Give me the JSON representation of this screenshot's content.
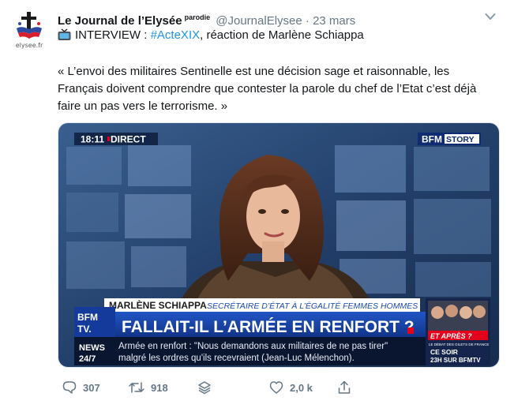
{
  "account": {
    "avatar_caption": "elysee.fr",
    "name": "Le Journal de l’Elysée",
    "parody_badge": "parodie",
    "handle": "@JournalElysee",
    "separator": "·",
    "date": "23 mars"
  },
  "tweet": {
    "prefix": "INTERVIEW : ",
    "hashtag": "#ActeXIX",
    "suffix": ", réaction de Marlène Schiappa",
    "quote": "« L’envoi des militaires Sentinelle est une décision sage et raisonnable, les Français doivent comprendre que contester la parole du chef de l’Etat c’est déjà faire un pas vers le terrorisme. »"
  },
  "media": {
    "time": "18:11",
    "live": "DIRECT",
    "channel_logo_a": "BFM",
    "channel_logo_b": "STORY",
    "guest_name": "MARLÈNE SCHIAPPA",
    "guest_title": "SECRÉTAIRE D’ÉTAT À L’ÉGALITÉ FEMMES HOMMES",
    "bfm_line1": "BFM",
    "bfm_line2": "TV.",
    "headline": "FALLAIT-IL L’ARMÉE EN RENFORT ?",
    "news_line1": "NEWS",
    "news_line2": "24/7",
    "ticker_line1": "Armée en renfort : \"Nous demandons aux militaires de ne pas tirer\"",
    "ticker_line2": "malgré les ordres qu'ils recevraient (Jean-Luc Mélenchon).",
    "promo_title": "ET APRÈS ?",
    "promo_sub": "LE DÉBAT DES GILETS DE FRANCE",
    "promo_line1": "CE SOIR",
    "promo_line2": "23H SUR BFMTV"
  },
  "actions": {
    "replies": "307",
    "retweets": "918",
    "likes": "2,0 k"
  },
  "icons": {
    "avatar": "elysee-cross-logo-icon",
    "tv": "television-icon",
    "caret": "chevron-down-icon",
    "reply": "reply-icon",
    "retweet": "retweet-icon",
    "stack": "stack-icon",
    "like": "heart-icon",
    "share": "share-icon"
  },
  "colors": {
    "hashtag": "#1b95e0",
    "muted": "#657786",
    "bfm_blue": "#14358f",
    "bfm_red": "#e2001a"
  }
}
